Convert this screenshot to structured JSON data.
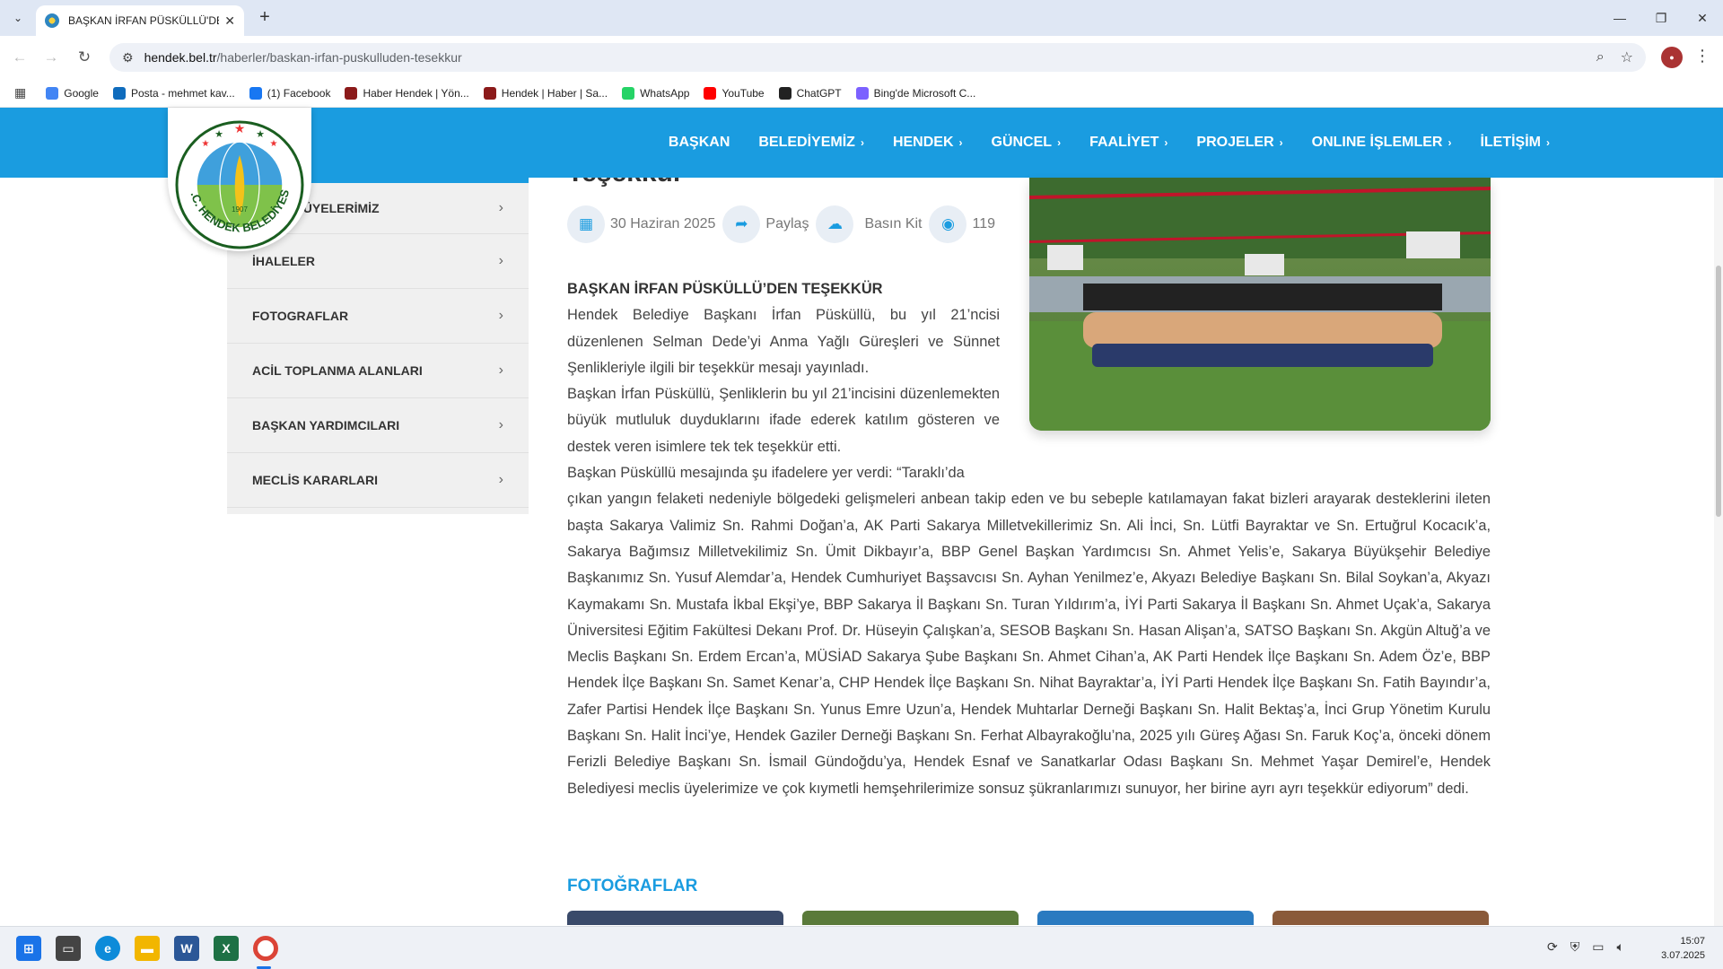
{
  "browser": {
    "tab_title": "BAŞKAN İRFAN PÜSKÜLLÜ'DEN",
    "url_host": "hendek.bel.tr",
    "url_path": "/haberler/baskan-irfan-puskulluden-tesekkur",
    "bookmarks": [
      {
        "label": "Google",
        "color": "#4285f4"
      },
      {
        "label": "Posta - mehmet kav...",
        "color": "#0f6cbd"
      },
      {
        "label": "(1) Facebook",
        "color": "#1877f2"
      },
      {
        "label": "Haber Hendek | Yön...",
        "color": "#8b1a1a"
      },
      {
        "label": "Hendek | Haber | Sa...",
        "color": "#8b1a1a"
      },
      {
        "label": "WhatsApp",
        "color": "#25d366"
      },
      {
        "label": "YouTube",
        "color": "#ff0000"
      },
      {
        "label": "ChatGPT",
        "color": "#222222"
      },
      {
        "label": "Bing'de Microsoft C...",
        "color": "#7b61ff"
      }
    ]
  },
  "site": {
    "logo_text": "T.C. HENDEK BELEDİYESİ",
    "logo_year": "1907",
    "nav": [
      {
        "label": "BAŞKAN",
        "chevron": false
      },
      {
        "label": "BELEDİYEMİZ",
        "chevron": true
      },
      {
        "label": "HENDEK",
        "chevron": true
      },
      {
        "label": "GÜNCEL",
        "chevron": true
      },
      {
        "label": "FAALİYET",
        "chevron": true
      },
      {
        "label": "PROJELER",
        "chevron": true
      },
      {
        "label": "ONLINE İŞLEMLER",
        "chevron": true
      },
      {
        "label": "İLETİŞİM",
        "chevron": true
      }
    ],
    "sidebar": [
      {
        "label": "MECLİS ÜYELERİMİZ"
      },
      {
        "label": "İHALELER"
      },
      {
        "label": "FOTOGRAFLAR"
      },
      {
        "label": "ACİL TOPLANMA ALANLARI"
      },
      {
        "label": "BAŞKAN YARDIMCILARI"
      },
      {
        "label": "MECLİS KARARLARI"
      }
    ]
  },
  "article": {
    "title_fragment": "Teşekkür",
    "date": "30 Haziran 2025",
    "share_label": "Paylaş",
    "press_kit_label": "Basın Kit",
    "views": "119",
    "lead": "BAŞKAN İRFAN PÜSKÜLLÜ’DEN TEŞEKKÜR",
    "para1": "Hendek Belediye Başkanı İrfan Püsküllü, bu yıl 21’ncisi düzenlenen Selman Dede’yi Anma Yağlı Güreşleri ve Sünnet Şenlikleriyle ilgili bir teşekkür mesajı yayınladı.",
    "para2": "Başkan İrfan Püsküllü, Şenliklerin bu yıl 21’incisini düzenlemekten büyük mutluluk duyduklarını ifade ederek katılım gösteren ve destek veren isimlere tek tek teşekkür etti.",
    "para3_a": "Başkan Püsküllü mesajında şu ifadelere yer verdi: “Taraklı’da",
    "para3_b": "çıkan yangın felaketi nedeniyle bölgedeki gelişmeleri anbean takip eden ve bu sebeple katılamayan fakat bizleri arayarak desteklerini ileten başta Sakarya Valimiz Sn. Rahmi Doğan’a, AK Parti Sakarya Milletvekillerimiz Sn. Ali İnci, Sn. Lütfi Bayraktar ve Sn. Ertuğrul Kocacık’a, Sakarya Bağımsız Milletvekilimiz Sn. Ümit Dikbayır’a, BBP Genel Başkan Yardımcısı Sn. Ahmet Yelis’e, Sakarya Büyükşehir Belediye Başkanımız Sn. Yusuf Alemdar’a, Hendek Cumhuriyet Başsavcısı Sn. Ayhan Yenilmez’e, Akyazı Belediye Başkanı Sn. Bilal Soykan’a, Akyazı Kaymakamı Sn. Mustafa İkbal Ekşi’ye, BBP Sakarya İl Başkanı Sn. Turan Yıldırım’a, İYİ Parti Sakarya İl Başkanı Sn. Ahmet Uçak’a, Sakarya Üniversitesi Eğitim Fakültesi Dekanı Prof. Dr. Hüseyin Çalışkan’a, SESOB Başkanı Sn. Hasan Alişan’a, SATSO Başkanı Sn. Akgün Altuğ’a ve Meclis Başkanı Sn. Erdem Ercan’a, MÜSİAD Sakarya Şube Başkanı Sn. Ahmet Cihan’a, AK Parti Hendek İlçe Başkanı Sn. Adem Öz’e, BBP Hendek İlçe Başkanı Sn. Samet Kenar’a, CHP Hendek İlçe Başkanı Sn. Nihat Bayraktar’a, İYİ Parti Hendek İlçe Başkanı Sn. Fatih Bayındır’a, Zafer Partisi Hendek İlçe Başkanı Sn. Yunus Emre Uzun’a, Hendek Muhtarlar Derneği Başkanı Sn. Halit Bektaş’a, İnci Grup Yönetim Kurulu Başkanı Sn. Halit İnci’ye, Hendek Gaziler Derneği Başkanı Sn. Ferhat Albayrakoğlu’na, 2025 yılı Güreş Ağası Sn. Faruk Koç’a, önceki dönem Ferizli Belediye Başkanı Sn. İsmail Gündoğdu’ya, Hendek Esnaf ve Sanatkarlar Odası Başkanı Sn. Mehmet Yaşar Demirel’e, Hendek Belediyesi meclis üyelerimize ve çok kıymetli hemşehrilerimize sonsuz şükranlarımızı sunuyor, her birine ayrı ayrı teşekkür ediyorum” dedi.",
    "photos_heading": "FOTOĞRAFLAR"
  },
  "taskbar": {
    "time": "15:07",
    "date": "3.07.2025"
  }
}
